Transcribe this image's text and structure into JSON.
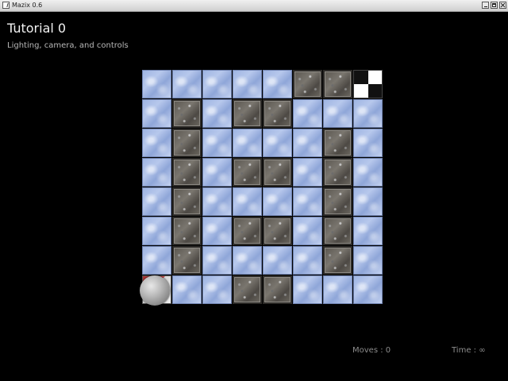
{
  "window": {
    "title": "Mazix 0.6"
  },
  "level": {
    "title": "Tutorial 0",
    "subtitle": "Lighting, camera, and controls"
  },
  "board": {
    "rows": [
      "IIIIISSG",
      "ISISSIII",
      "ISIIIISI",
      "ISISSISI",
      "ISIIIISI",
      "ISISSISI",
      "ISIIIISI",
      "BIISSIII"
    ],
    "legend": {
      "I": "ice",
      "S": "stone",
      "G": "goal",
      "B": "start"
    }
  },
  "player": {
    "row": 7,
    "col": 0,
    "icon": "ball-icon"
  },
  "hud": {
    "moves": "Moves : 0",
    "time": "Time : ∞"
  }
}
